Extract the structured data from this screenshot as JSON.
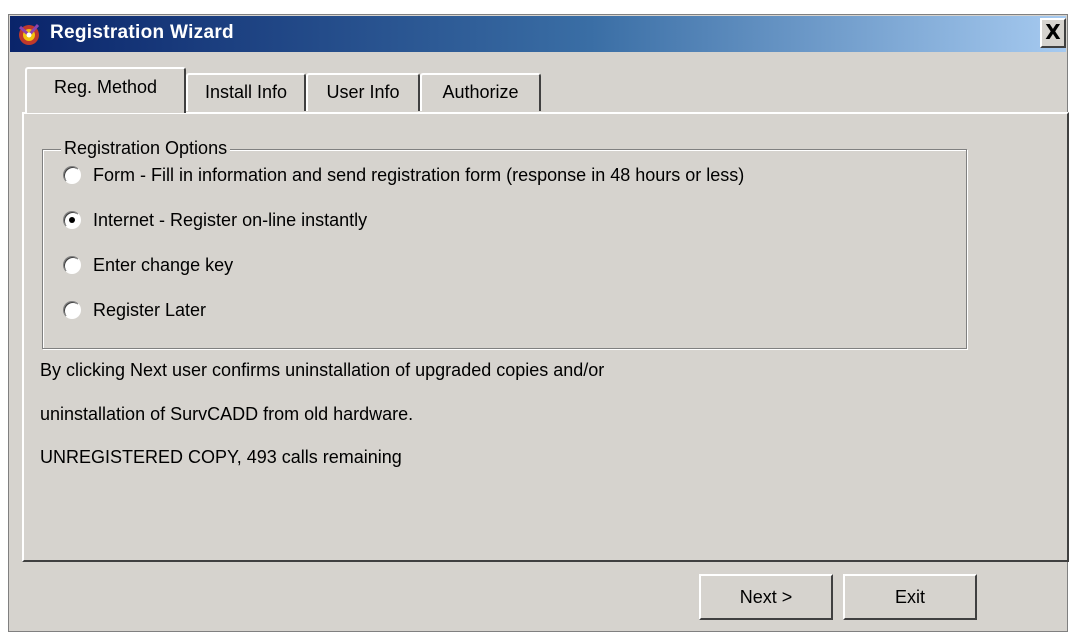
{
  "window": {
    "title": "Registration Wizard",
    "close_label": "X"
  },
  "tabs": [
    {
      "label": "Reg. Method",
      "active": true
    },
    {
      "label": "Install Info",
      "active": false
    },
    {
      "label": "User Info",
      "active": false
    },
    {
      "label": "Authorize",
      "active": false
    }
  ],
  "registration_options": {
    "legend": "Registration Options",
    "options": [
      {
        "label": "Form - Fill in information and send registration form (response in 48 hours or less)",
        "selected": false
      },
      {
        "label": "Internet - Register on-line instantly",
        "selected": true
      },
      {
        "label": "Enter change key",
        "selected": false
      },
      {
        "label": "Register Later",
        "selected": false
      }
    ]
  },
  "info": {
    "line1": "By clicking Next user confirms uninstallation of upgraded copies and/or",
    "line2": "uninstallation of SurvCADD from old hardware.",
    "status": "UNREGISTERED COPY, 493 calls remaining"
  },
  "buttons": {
    "next_label": "Next >",
    "exit_label": "Exit"
  },
  "icons": {
    "app": "app-icon",
    "close": "close-icon"
  }
}
